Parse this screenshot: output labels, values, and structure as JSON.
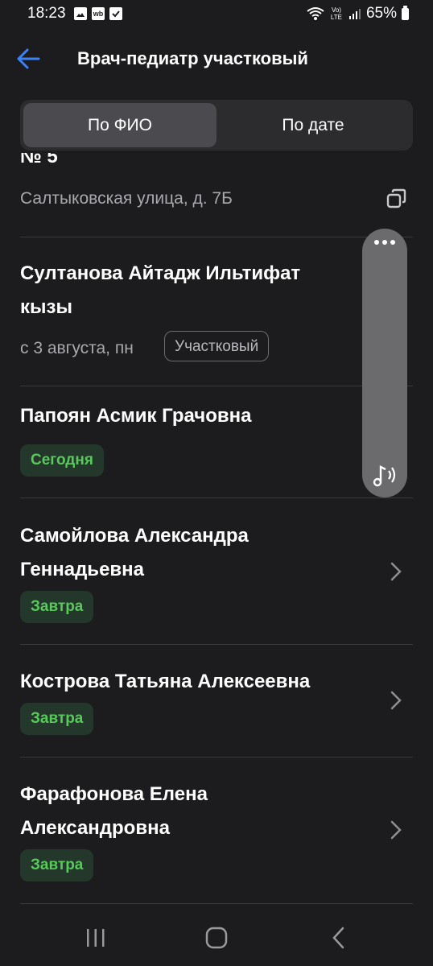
{
  "status_bar": {
    "time": "18:23",
    "left_icons": [
      "gallery-icon",
      "wb-icon",
      "checkbox-icon"
    ],
    "wb_label": "wb",
    "right_icons": [
      "wifi-icon",
      "volte-icon",
      "signal-icon"
    ],
    "volte_label": "Vo) LTE",
    "battery": "65%"
  },
  "header": {
    "title": "Врач-педиатр участковый",
    "back_icon": "arrow-left-icon"
  },
  "tabs": [
    {
      "label": "По ФИО",
      "active": true
    },
    {
      "label": "По дате",
      "active": false
    }
  ],
  "list": {
    "partial_item": {
      "name_fragment": "№ 5",
      "address": "Салтыковская улица, д. 7Б",
      "copy_icon": "copy-icon"
    },
    "doctors": [
      {
        "name_line1": "Султанова Айтадж Ильтифат",
        "name_line2": "кызы",
        "date": "с 3 августа, пн",
        "tag": "Участковый"
      },
      {
        "name_line1": "Папоян Асмик Грачовна",
        "availability": "Сегодня"
      },
      {
        "name_line1": "Самойлова Александра",
        "name_line2": "Геннадьевна",
        "availability": "Завтра"
      },
      {
        "name_line1": "Кострова Татьяна Алексеевна",
        "availability": "Завтра"
      },
      {
        "name_line1": "Фарафонова Елена",
        "name_line2": "Александровна",
        "availability": "Завтра"
      }
    ]
  },
  "floating_panel": {
    "menu_icon": "more-dots-icon",
    "sound_icon": "music-note-sound-icon"
  },
  "nav_bar": {
    "buttons": [
      "recents-icon",
      "home-icon",
      "back-icon"
    ]
  },
  "colors": {
    "background": "#1c1c1e",
    "accent_blue": "#3b82f6",
    "green_badge_text": "#59c95c",
    "green_badge_bg": "#23382a"
  }
}
